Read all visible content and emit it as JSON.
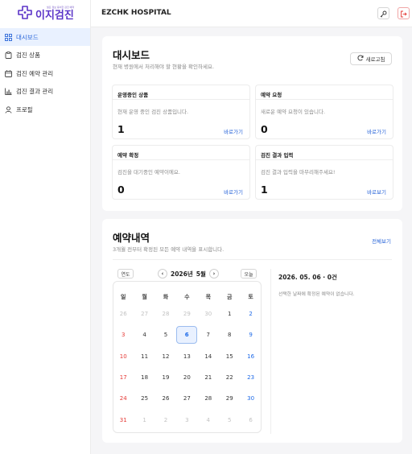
{
  "app": {
    "logo_tagline": "필요 정보 용이한 검진 예약",
    "logo_name": "이지검진"
  },
  "sidebar": {
    "items": [
      {
        "label": "대시보드",
        "icon": "grid-icon",
        "active": true
      },
      {
        "label": "검진 상품",
        "icon": "clipboard-icon",
        "active": false
      },
      {
        "label": "검진 예약 관리",
        "icon": "calendar-icon",
        "active": false
      },
      {
        "label": "검진 결과 관리",
        "icon": "bar-chart-icon",
        "active": false
      },
      {
        "label": "프로필",
        "icon": "user-icon",
        "active": false
      }
    ]
  },
  "header": {
    "title": "EZCHK HOSPITAL"
  },
  "dashboard": {
    "title": "대시보드",
    "subtitle": "현재 병원에서 처리해야 할 현황을 확인하세요.",
    "refresh_label": "새로고침",
    "stats": [
      {
        "title": "운영중인 상품",
        "desc": "현재 운영 중인 검진 상품입니다.",
        "count": "1",
        "link": "바로가기"
      },
      {
        "title": "예약 요청",
        "desc": "새로운 예약 요청이 있습니다.",
        "count": "0",
        "link": "바로가기"
      },
      {
        "title": "예약 확정",
        "desc": "검진을 대기중인 예약이에요.",
        "count": "0",
        "link": "바로가기"
      },
      {
        "title": "검진 결과 입력",
        "desc": "검진 결과 입력을 마무리해주세요!",
        "count": "1",
        "link": "바로보기"
      }
    ]
  },
  "reservations": {
    "title": "예약내역",
    "subtitle": "3개월 전부터 확정된 모든 예약 내역을 표시합니다.",
    "view_all": "전체보기",
    "calendar": {
      "year_button": "연도",
      "today_button": "오늘",
      "year": "2026년",
      "month": "5월",
      "weekdays": [
        "일",
        "월",
        "화",
        "수",
        "목",
        "금",
        "토"
      ],
      "weeks": [
        [
          "26",
          "27",
          "28",
          "29",
          "30",
          "1",
          "2"
        ],
        [
          "3",
          "4",
          "5",
          "6",
          "7",
          "8",
          "9"
        ],
        [
          "10",
          "11",
          "12",
          "13",
          "14",
          "15",
          "16"
        ],
        [
          "17",
          "18",
          "19",
          "20",
          "21",
          "22",
          "23"
        ],
        [
          "24",
          "25",
          "26",
          "27",
          "28",
          "29",
          "30"
        ],
        [
          "31",
          "1",
          "2",
          "3",
          "4",
          "5",
          "6"
        ]
      ],
      "selected_day": "6"
    },
    "detail_date": "2026. 05. 06 · 0건",
    "detail_message": "선택한 날짜에 확정된 예약이 없습니다."
  }
}
